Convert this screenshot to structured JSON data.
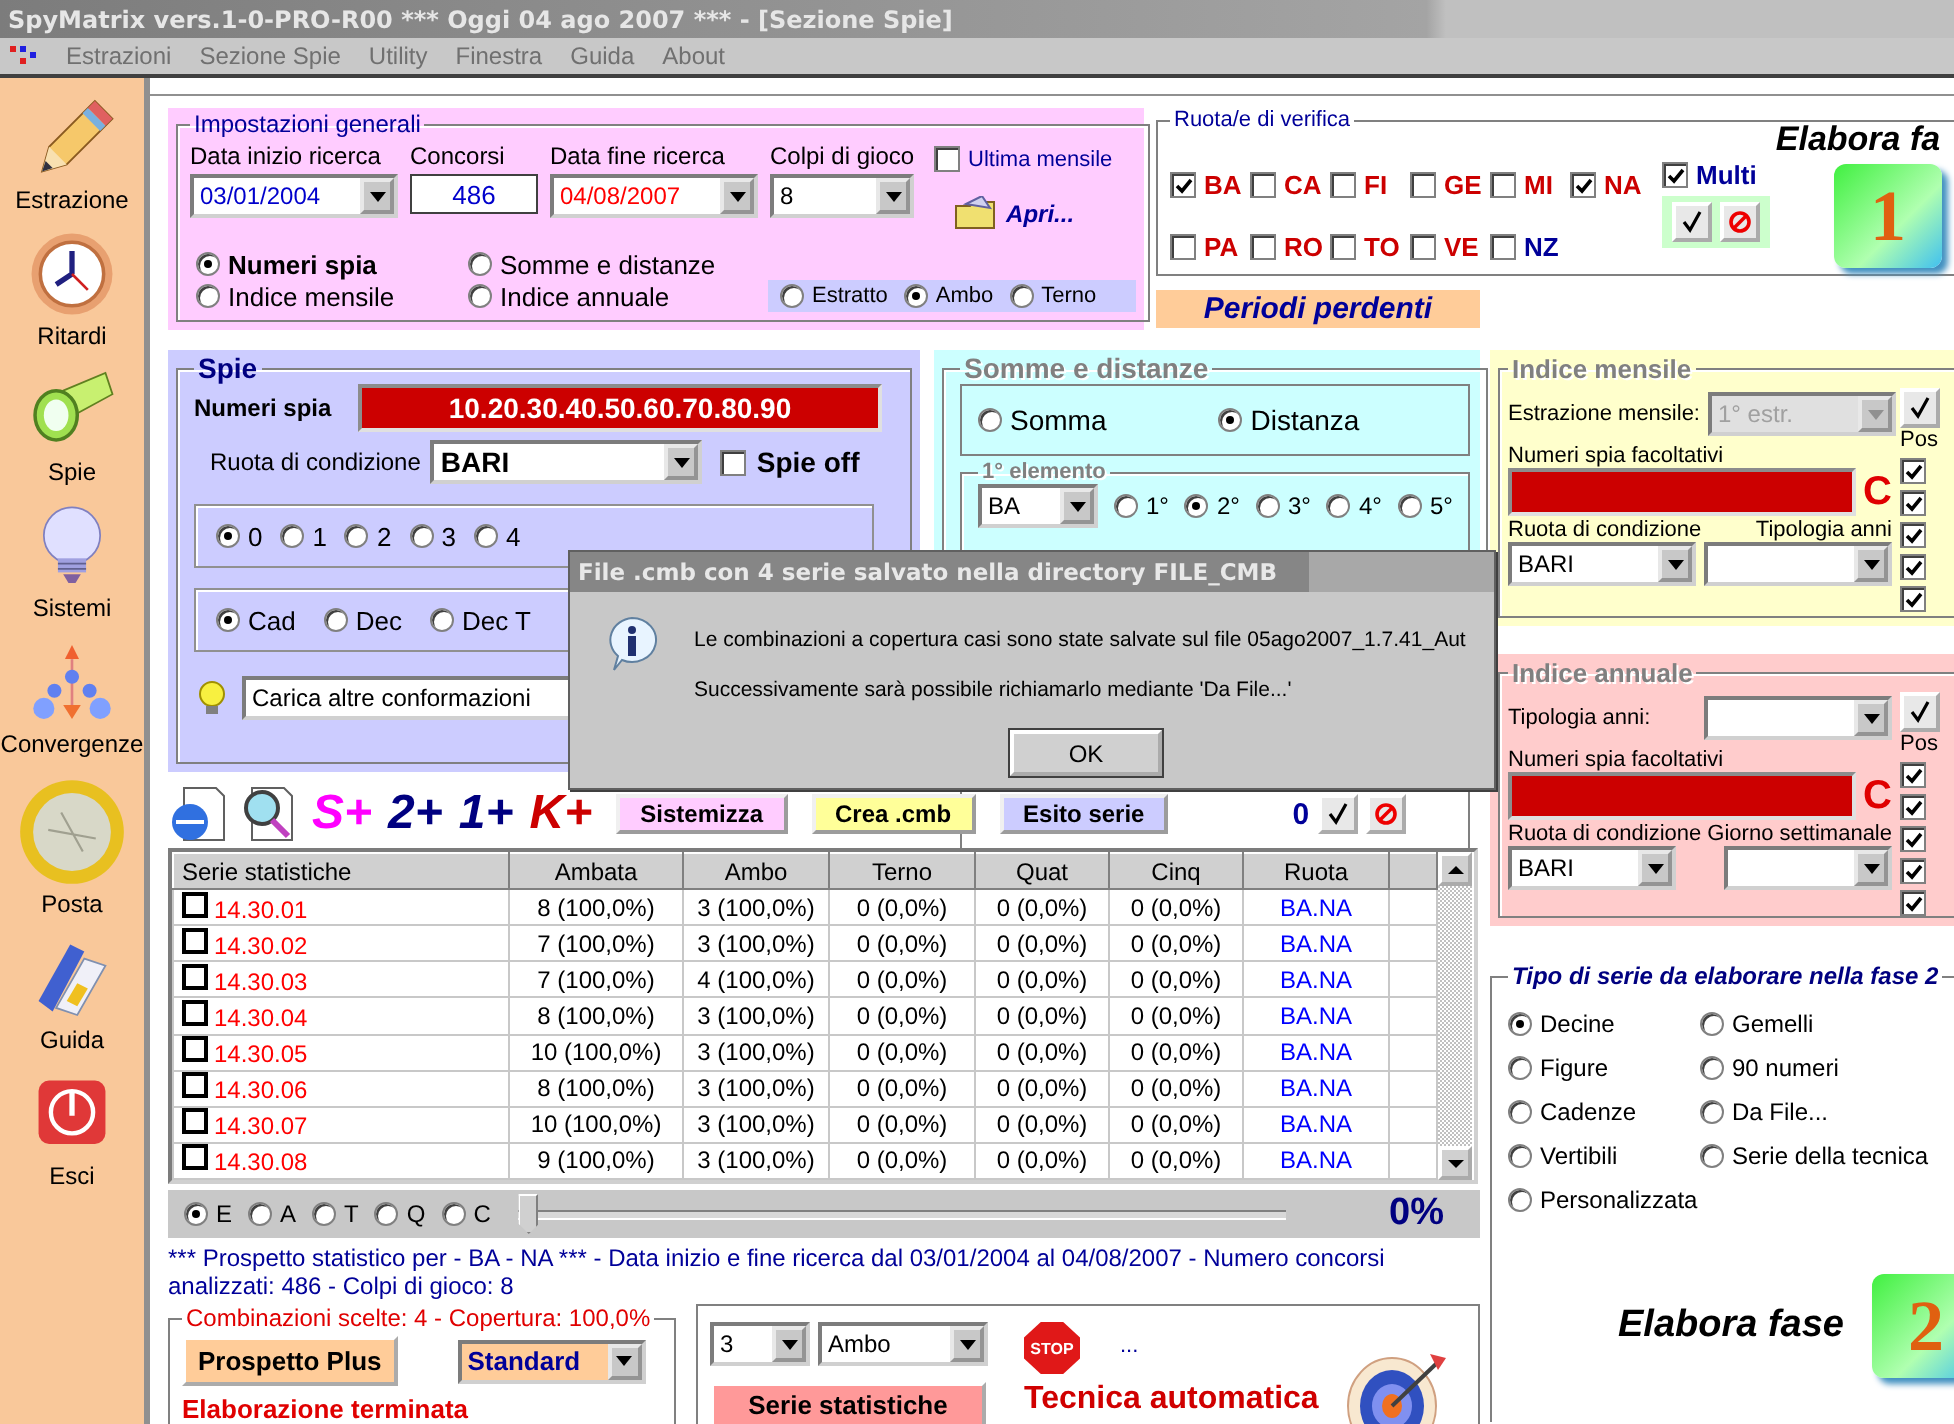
{
  "window": {
    "title": "SpyMatrix vers.1-0-PRO-R00 *** Oggi 04 ago 2007 *** - [Sezione Spie]"
  },
  "menu": [
    "Estrazioni",
    "Sezione Spie",
    "Utility",
    "Finestra",
    "Guida",
    "About"
  ],
  "sidebar": {
    "items": [
      {
        "label": "Estrazione",
        "kind": "pencil"
      },
      {
        "label": "Ritardi",
        "kind": "clock"
      },
      {
        "label": "Spie",
        "kind": "flashlight"
      },
      {
        "label": "Sistemi",
        "kind": "bulb"
      },
      {
        "label": "Convergenze",
        "kind": "network"
      },
      {
        "label": "Posta",
        "kind": "coin"
      },
      {
        "label": "Guida",
        "kind": "book"
      },
      {
        "label": "Esci",
        "kind": "power"
      }
    ]
  },
  "settings": {
    "title": "Impostazioni generali",
    "fields": [
      {
        "kind": "combo",
        "label": "Data inizio ricerca",
        "value": "03/01/2004",
        "color": "#0000cc"
      },
      {
        "kind": "text",
        "label": "Concorsi",
        "value": "486",
        "color": "#0000cc"
      },
      {
        "kind": "combo",
        "label": "Data fine ricerca",
        "value": "04/08/2007",
        "color": "#ff0000"
      },
      {
        "kind": "combo",
        "label": "Colpi di gioco",
        "value": "8",
        "color": "#000000"
      }
    ],
    "last_monthly": {
      "label": "Ultima mensile",
      "checked": false
    },
    "open_button": "Apri...",
    "modes": [
      {
        "label": "Numeri spia",
        "selected": true
      },
      {
        "label": "Indice mensile",
        "selected": false
      },
      {
        "label": "Somme e distanze",
        "selected": false
      },
      {
        "label": "Indice annuale",
        "selected": false
      }
    ],
    "play_types": [
      {
        "label": "Estratto",
        "selected": false
      },
      {
        "label": "Ambo",
        "selected": true
      },
      {
        "label": "Terno",
        "selected": false
      }
    ]
  },
  "verify": {
    "title": "Ruota/e di verifica",
    "wheels": [
      {
        "label": "BA",
        "checked": true,
        "color": "#cc0000"
      },
      {
        "label": "CA",
        "checked": false,
        "color": "#cc0000"
      },
      {
        "label": "FI",
        "checked": false,
        "color": "#cc0000"
      },
      {
        "label": "GE",
        "checked": false,
        "color": "#cc0000"
      },
      {
        "label": "MI",
        "checked": false,
        "color": "#cc0000"
      },
      {
        "label": "NA",
        "checked": true,
        "color": "#cc0000"
      },
      {
        "label": "PA",
        "checked": false,
        "color": "#cc0000"
      },
      {
        "label": "RO",
        "checked": false,
        "color": "#cc0000"
      },
      {
        "label": "TO",
        "checked": false,
        "color": "#cc0000"
      },
      {
        "label": "VE",
        "checked": false,
        "color": "#cc0000"
      },
      {
        "label": "NZ",
        "checked": false,
        "color": "#000099"
      }
    ],
    "multi": {
      "label": "Multi",
      "checked": true
    },
    "phase_label": "Elabora fa",
    "phase_number": "1"
  },
  "periods_label": "Periodi perdenti",
  "spie": {
    "title": "Spie",
    "numbers_label": "Numeri spia",
    "numbers": "10.20.30.40.50.60.70.80.90",
    "wheel_label": "Ruota di condizione",
    "wheel": "BARI",
    "off": {
      "label": "Spie off",
      "checked": false
    },
    "digits": [
      {
        "label": "0",
        "selected": true
      },
      {
        "label": "1",
        "selected": false
      },
      {
        "label": "2",
        "selected": false
      },
      {
        "label": "3",
        "selected": false
      },
      {
        "label": "4",
        "selected": false
      }
    ],
    "groups": [
      {
        "label": "Cad",
        "selected": true
      },
      {
        "label": "Dec",
        "selected": false
      },
      {
        "label": "Dec T",
        "selected": false
      }
    ],
    "load": "Carica altre conformazioni"
  },
  "sums": {
    "title": "Somme e distanze",
    "modes": [
      {
        "label": "Somma",
        "selected": false
      },
      {
        "label": "Distanza",
        "selected": true
      }
    ],
    "element": {
      "title": "1° elemento",
      "wheel": "BA",
      "positions": [
        {
          "label": "1°",
          "selected": false
        },
        {
          "label": "2°",
          "selected": true
        },
        {
          "label": "3°",
          "selected": false
        },
        {
          "label": "4°",
          "selected": false
        },
        {
          "label": "5°",
          "selected": false
        }
      ]
    }
  },
  "toolbar": {
    "tags": [
      {
        "label": "S+",
        "color": "#ff00ff"
      },
      {
        "label": "2+",
        "color": "#000080"
      },
      {
        "label": "1+",
        "color": "#000080"
      },
      {
        "label": "K+",
        "color": "#cc0000"
      }
    ],
    "buttons": [
      {
        "label": "Sistemizza",
        "color": "#ffccff"
      },
      {
        "label": "Crea .cmb",
        "color": "#ffff99"
      },
      {
        "label": "Esito serie",
        "color": "#ccccff"
      }
    ],
    "count": "0"
  },
  "table": {
    "columns": [
      "Serie statistiche",
      "Ambata",
      "Ambo",
      "Terno",
      "Quat",
      "Cinq",
      "Ruota"
    ],
    "rows": [
      {
        "checked": false,
        "cells": [
          "14.30.01",
          "8 (100,0%)",
          "3 (100,0%)",
          "0 (0,0%)",
          "0 (0,0%)",
          "0 (0,0%)",
          "BA.NA"
        ]
      },
      {
        "checked": false,
        "cells": [
          "14.30.02",
          "7 (100,0%)",
          "3 (100,0%)",
          "0 (0,0%)",
          "0 (0,0%)",
          "0 (0,0%)",
          "BA.NA"
        ]
      },
      {
        "checked": false,
        "cells": [
          "14.30.03",
          "7 (100,0%)",
          "4 (100,0%)",
          "0 (0,0%)",
          "0 (0,0%)",
          "0 (0,0%)",
          "BA.NA"
        ]
      },
      {
        "checked": false,
        "cells": [
          "14.30.04",
          "8 (100,0%)",
          "3 (100,0%)",
          "0 (0,0%)",
          "0 (0,0%)",
          "0 (0,0%)",
          "BA.NA"
        ]
      },
      {
        "checked": false,
        "cells": [
          "14.30.05",
          "10 (100,0%)",
          "3 (100,0%)",
          "0 (0,0%)",
          "0 (0,0%)",
          "0 (0,0%)",
          "BA.NA"
        ]
      },
      {
        "checked": false,
        "cells": [
          "14.30.06",
          "8 (100,0%)",
          "3 (100,0%)",
          "0 (0,0%)",
          "0 (0,0%)",
          "0 (0,0%)",
          "BA.NA"
        ]
      },
      {
        "checked": false,
        "cells": [
          "14.30.07",
          "10 (100,0%)",
          "3 (100,0%)",
          "0 (0,0%)",
          "0 (0,0%)",
          "0 (0,0%)",
          "BA.NA"
        ]
      },
      {
        "checked": false,
        "cells": [
          "14.30.08",
          "9 (100,0%)",
          "3 (100,0%)",
          "0 (0,0%)",
          "0 (0,0%)",
          "0 (0,0%)",
          "BA.NA"
        ]
      }
    ]
  },
  "progress": {
    "options": [
      {
        "label": "E",
        "selected": true
      },
      {
        "label": "A",
        "selected": false
      },
      {
        "label": "T",
        "selected": false
      },
      {
        "label": "Q",
        "selected": false
      },
      {
        "label": "C",
        "selected": false
      }
    ],
    "level": 0,
    "reading": "0%"
  },
  "summary": "*** Prospetto statistico per - BA - NA *** - Data inizio e fine ricerca dal 03/01/2004 al 04/08/2007 - Numero concorsi analizzati: 486 - Colpi di gioco: 8",
  "combinations": {
    "title": "Combinazioni scelte: 4 - Copertura: 100,0%",
    "button": "Prospetto Plus",
    "style": "Standard",
    "status": "Elaborazione terminata"
  },
  "technique": {
    "count": "3",
    "type": "Ambo",
    "stop": "STOP",
    "ellipsis": "...",
    "button": "Serie statistiche",
    "title": "Tecnica automatica"
  },
  "monthly": {
    "title": "Indice mensile",
    "extraction_label": "Estrazione mensile:",
    "extraction": "1° estr.",
    "extraction_disabled": true,
    "optional_label": "Numeri spia facoltativi",
    "clear": "C",
    "wheel_label": "Ruota di condizione",
    "wheel": "BARI",
    "years_label": "Tipologia anni",
    "pos_label": "Pos",
    "pos": [
      {
        "checked": true
      },
      {
        "checked": true
      },
      {
        "checked": true
      },
      {
        "checked": true
      },
      {
        "checked": true
      }
    ]
  },
  "annual": {
    "title": "Indice annuale",
    "years_label": "Tipologia anni:",
    "optional_label": "Numeri spia facoltativi",
    "clear": "C",
    "wheel_label": "Ruota di condizione",
    "wheel": "BARI",
    "day_label": "Giorno settimanale",
    "pos_label": "Pos",
    "pos": [
      {
        "checked": true
      },
      {
        "checked": true
      },
      {
        "checked": true
      },
      {
        "checked": true
      },
      {
        "checked": true
      }
    ]
  },
  "series_type": {
    "title": "Tipo di serie da elaborare nella fase 2",
    "options": [
      {
        "label": "Decine",
        "selected": true
      },
      {
        "label": "Gemelli",
        "selected": false
      },
      {
        "label": "Figure",
        "selected": false
      },
      {
        "label": "90 numeri",
        "selected": false
      },
      {
        "label": "Cadenze",
        "selected": false
      },
      {
        "label": "Da File...",
        "selected": false
      },
      {
        "label": "Vertibili",
        "selected": false
      },
      {
        "label": "Serie della tecnica",
        "selected": false
      },
      {
        "label": "Personalizzata",
        "selected": false
      }
    ]
  },
  "phase2": {
    "label": "Elabora fase",
    "number": "2"
  },
  "dialog": {
    "title": "File .cmb con 4 serie salvato nella directory FILE_CMB",
    "lines": [
      "Le combinazioni a copertura casi sono state salvate sul file 05ago2007_1.7.41_Aut",
      "Successivamente sarà possibile richiamarlo mediante 'Da File...'"
    ],
    "button": "OK"
  }
}
